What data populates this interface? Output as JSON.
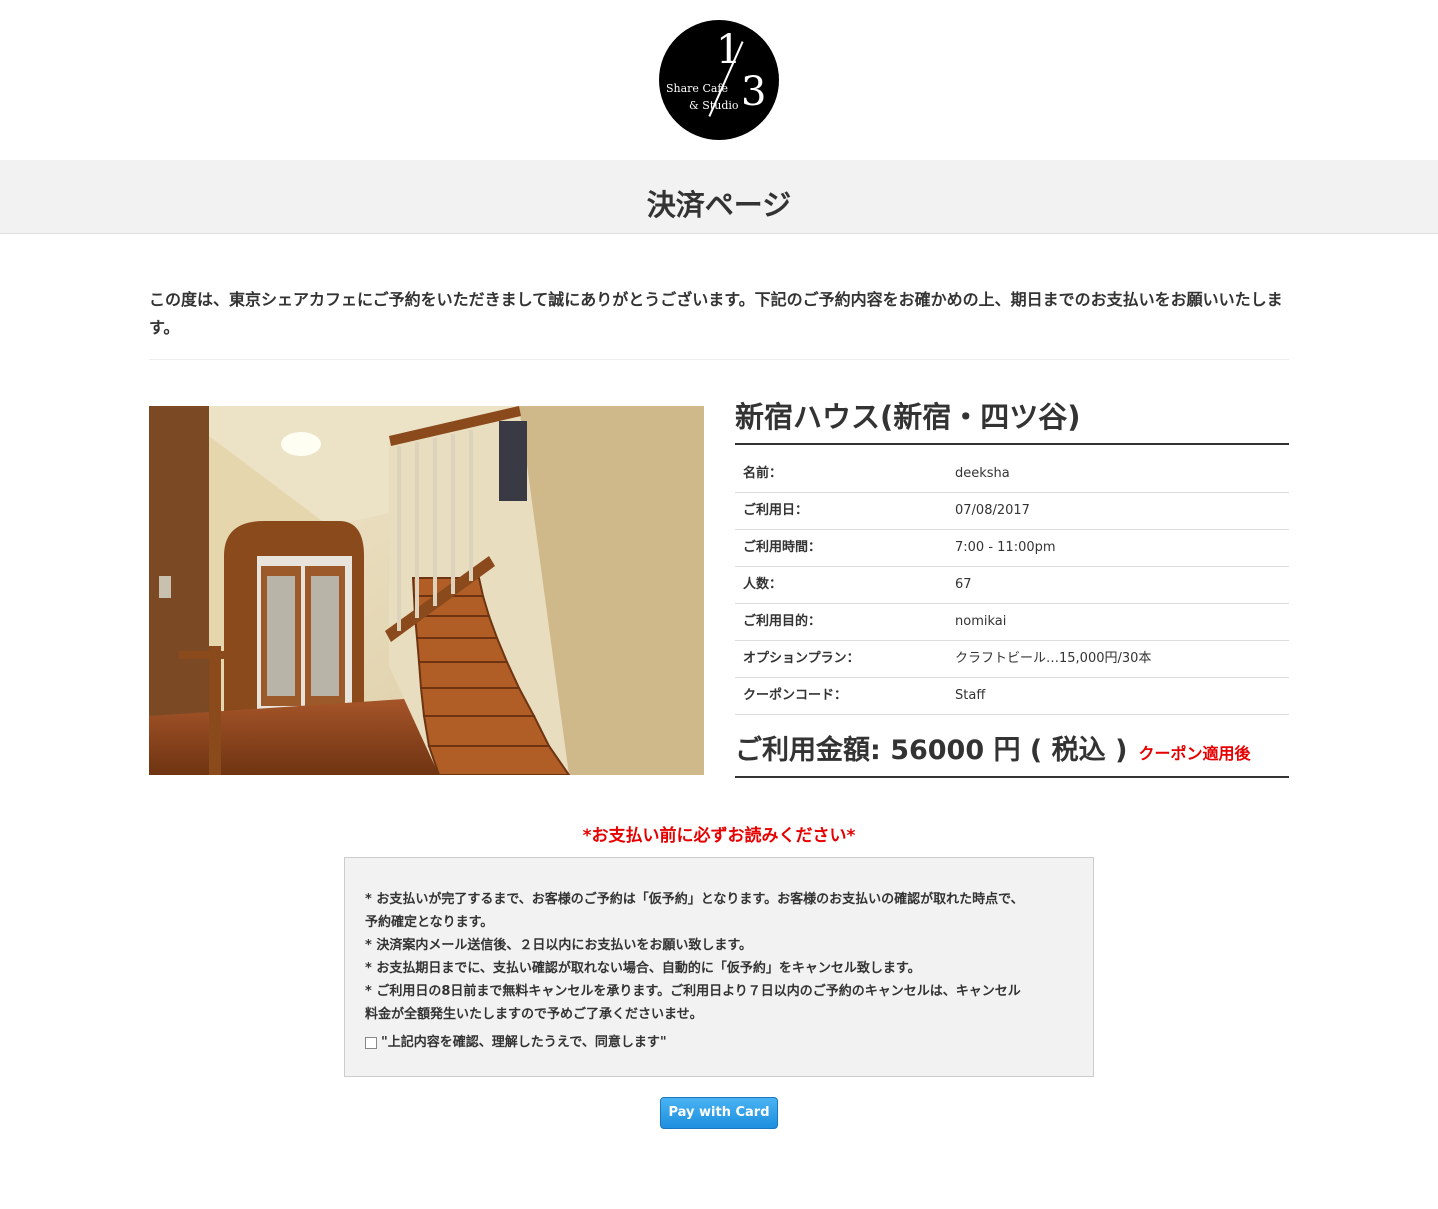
{
  "logo": {
    "numerator": "1",
    "denominator": "3",
    "line1": "Share Cafe",
    "line2": "& Studio"
  },
  "page_title": "決済ページ",
  "intro_text": "この度は、東京シェアカフェにご予約をいただきまして誠にありがとうございます。下記のご予約内容をお確かめの上、期日までのお支払いをお願いいたします。",
  "venue": {
    "name": "新宿ハウス(新宿・四ツ谷)"
  },
  "booking": [
    {
      "label": "名前：",
      "value": "deeksha"
    },
    {
      "label": "ご利用日：",
      "value": "07/08/2017"
    },
    {
      "label": "ご利用時間：",
      "value": "7:00 - 11:00pm"
    },
    {
      "label": "人数：",
      "value": "67"
    },
    {
      "label": "ご利用目的：",
      "value": "nomikai"
    },
    {
      "label": "オプションプラン：",
      "value": "クラフトビール…15,000円/30本"
    },
    {
      "label": "クーポンコード：",
      "value": "Staff"
    }
  ],
  "total": {
    "amount_text": "ご利用金額: 56000 円 ( 税込 )",
    "coupon_note": "クーポン適用後"
  },
  "notice": {
    "heading": "*お支払い前に必ずお読みください*",
    "lines": [
      "* お支払いが完了するまで、お客様のご予約は「仮予約」となります。お客様のお支払いの確認が取れた時点で、",
      "予約確定となります。",
      "* 決済案内メール送信後、２日以内にお支払いをお願い致します。",
      "* お支払期日までに、支払い確認が取れない場合、自動的に「仮予約」をキャンセル致します。",
      "* ご利用日の8日前まで無料キャンセルを承ります。ご利用日より７日以内のご予約のキャンセルは、キャンセル",
      "料金が全額発生いたしますので予めご了承くださいませ。"
    ],
    "agree_label": "\"上記内容を確認、理解したうえで、同意します\"",
    "agree_checked": false
  },
  "pay_button": "Pay with Card",
  "colors": {
    "accent_red": "#e60000",
    "button_blue": "#1d8fdf",
    "band_gray": "#f2f2f2"
  }
}
